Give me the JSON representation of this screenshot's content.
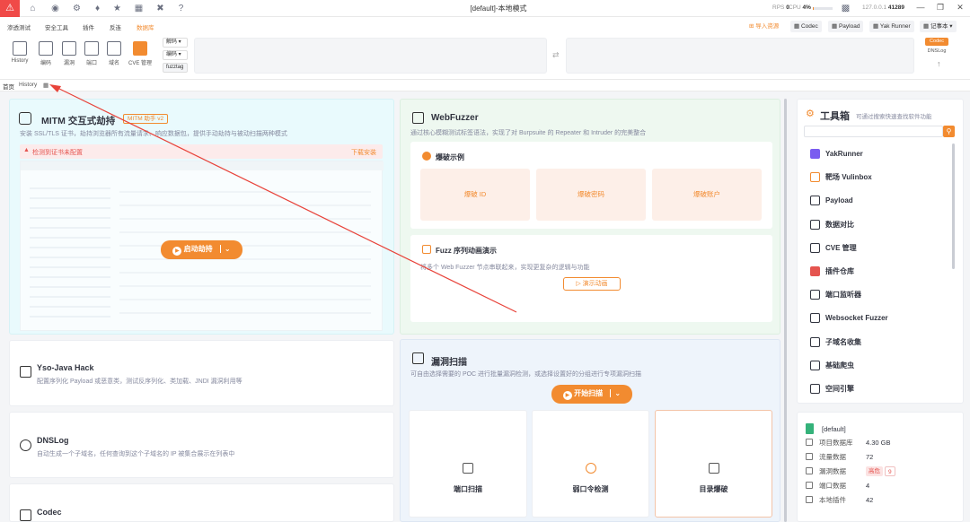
{
  "titlebar": {
    "title": "[default]-本地模式",
    "stats": {
      "rps_label": "RPS",
      "rps_value": "0",
      "cpu_label": "CPU",
      "cpu_value": "4%",
      "host": "127.0.0.1",
      "port": "41289"
    },
    "icons": [
      "home-icon",
      "user-icon",
      "settings-icon",
      "bell-icon",
      "bug-icon",
      "terminal-icon",
      "tools-icon",
      "help-icon"
    ]
  },
  "menubar": {
    "items": [
      "渗透测试",
      "安全工具",
      "插件",
      "反连",
      "数据库"
    ],
    "right_buttons": [
      "导入资源",
      "Codec",
      "Payload",
      "Yak Runner",
      "记事本"
    ]
  },
  "toolbar": {
    "tools": [
      "History",
      "编码",
      "漏洞",
      "端口",
      "域名",
      "CVE 管理"
    ],
    "select_decode": "解码",
    "select_encode": "编码",
    "fuzztag_label": "fuzztag",
    "right_tags": [
      "Codec",
      "DNSLog"
    ]
  },
  "tabs": {
    "home": "首页",
    "history": "History"
  },
  "mitm": {
    "title": "MITM 交互式劫持",
    "badge": "MITM 助手 v2",
    "desc": "安装 SSL/TLS 证书，劫持浏览器所有流量请求、响应数据包，提供手动劫持与被动扫描两种模式",
    "warning": "检测到证书未配置",
    "install_link": "下载安装",
    "start_button": "启动劫持"
  },
  "webfuzzer": {
    "title": "WebFuzzer",
    "desc": "通过核心模糊测试标签语法，实现了对 Burpsuite 的 Repeater 和 Intruder 的完美整合",
    "examples_title": "爆破示例",
    "tiles": [
      "爆破 ID",
      "爆破密码",
      "爆破账户"
    ],
    "sequence_title": "Fuzz 序列动画演示",
    "sequence_desc": "将多个 Web Fuzzer 节点串联起来，实现更复杂的逻辑与功能",
    "demo_button": "演示动画"
  },
  "yso": {
    "title": "Yso-Java Hack",
    "desc": "配置序列化 Payload 或恶意类，测试反序列化、类加载、JNDI 漏洞利用等"
  },
  "dnslog": {
    "title": "DNSLog",
    "desc": "自动生成一个子域名，任何查询到这个子域名的 IP 被集合展示在列表中"
  },
  "codec": {
    "title": "Codec"
  },
  "vulnscan": {
    "title": "漏洞扫描",
    "desc": "可自由选择需要的 POC 进行批量漏洞检测，或选择设置好的分组进行专项漏洞扫描",
    "start_button": "开始扫描",
    "cards": [
      "端口扫描",
      "弱口令检测",
      "目录爆破"
    ]
  },
  "toolbox": {
    "title": "工具箱",
    "subtitle": "可通过搜索快速查找软件功能",
    "items": [
      "YakRunner",
      "靶场 Vulinbox",
      "Payload",
      "数据对比",
      "CVE 管理",
      "插件仓库",
      "端口监听器",
      "Websocket Fuzzer",
      "子域名收集",
      "基础爬虫",
      "空间引擎"
    ]
  },
  "database": {
    "name": "[default]",
    "rows": [
      {
        "label": "项目数据库",
        "value": "4.30 GB"
      },
      {
        "label": "流量数据",
        "value": "72"
      },
      {
        "label": "漏洞数据",
        "value": "",
        "tag": "高危",
        "count": "9"
      },
      {
        "label": "端口数据",
        "value": "4"
      },
      {
        "label": "本地插件",
        "value": "42"
      }
    ]
  },
  "colors": {
    "accent": "#f28b30",
    "logo": "#f04a48",
    "arrow": "#e8433a"
  }
}
